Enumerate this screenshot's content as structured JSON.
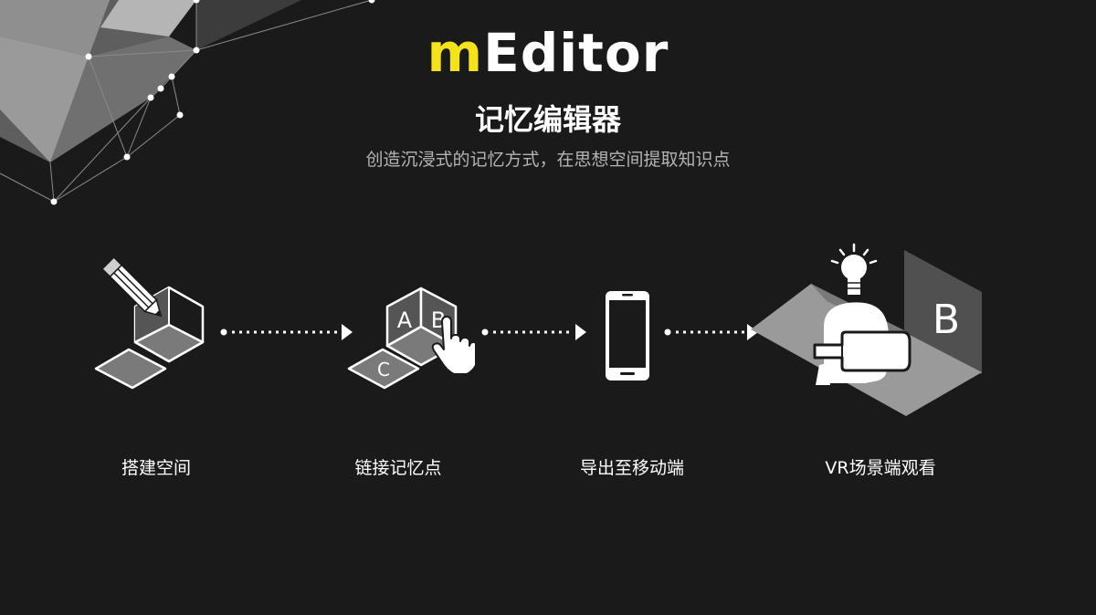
{
  "header": {
    "title_accent": "m",
    "title_rest": "Editor",
    "subtitle": "记忆编辑器",
    "tagline": "创造沉浸式的记忆方式，在思想空间提取知识点"
  },
  "steps": [
    {
      "label": "搭建空间",
      "icon": "build-space-icon"
    },
    {
      "label": "链接记忆点",
      "icon": "link-memory-points-icon",
      "letters": [
        "A",
        "B",
        "C"
      ]
    },
    {
      "label": "导出至移动端",
      "icon": "smartphone-icon"
    },
    {
      "label": "VR场景端观看",
      "icon": "vr-headset-icon",
      "letters": [
        "B"
      ]
    }
  ],
  "colors": {
    "background": "#1a1a1a",
    "accent": "#f4e21c",
    "text": "#ffffff",
    "muted": "#b4b4b4"
  }
}
